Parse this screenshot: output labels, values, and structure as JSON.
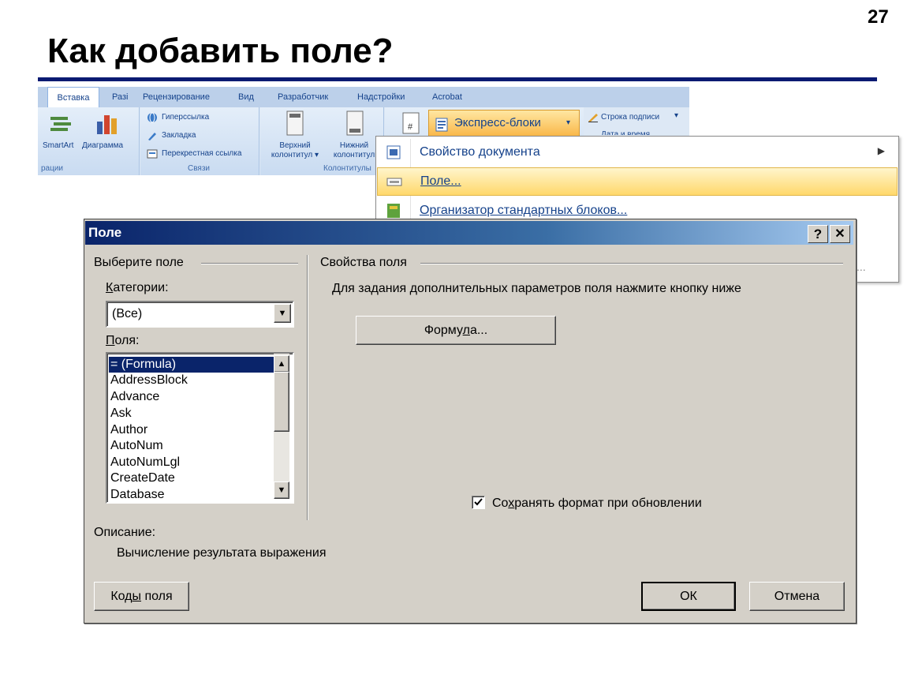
{
  "slide": {
    "number": "27",
    "title": "Как добавить поле?"
  },
  "ribbon": {
    "tabs": [
      {
        "label": "Вставка"
      },
      {
        "label": "Разі"
      },
      {
        "label": "Рецензирование"
      },
      {
        "label": "Вид"
      },
      {
        "label": "Разработчик"
      },
      {
        "label": "Надстройки"
      },
      {
        "label": "Acrobat"
      }
    ],
    "illustrations": {
      "smartart": "SmartArt",
      "chart": "Диаграмма",
      "group_label": "рации"
    },
    "links": {
      "hyperlink": "Гиперссылка",
      "bookmark": "Закладка",
      "crossref": "Перекрестная ссылка",
      "group_label": "Связи"
    },
    "header_footer": {
      "header_line1": "Верхний",
      "header_line2": "колонтитул ▾",
      "footer_line1": "Нижний",
      "footer_line2": "колонтитул",
      "group_label": "Колонтитулы"
    },
    "express_blocks": "Экспресс-блоки",
    "signature_line": "Строка подписи",
    "datetime_partial": "Дата и время"
  },
  "menu": {
    "items": [
      {
        "label": "Свойство документа",
        "has_submenu": true
      },
      {
        "label": "Поле...",
        "highlighted": true
      },
      {
        "label": "Организатор стандартных блоков..."
      }
    ],
    "ellipsis": "..."
  },
  "dialog": {
    "title": "Поле",
    "help": "?",
    "close": "✕",
    "select_field_group": "Выберите поле",
    "categories_label": "Категории:",
    "categories_value": "(Все)",
    "fields_label": "Поля:",
    "fields": [
      "= (Formula)",
      "AddressBlock",
      "Advance",
      "Ask",
      "Author",
      "AutoNum",
      "AutoNumLgl",
      "CreateDate",
      "Database"
    ],
    "selected_field": "= (Formula)",
    "props_group": "Свойства поля",
    "props_hint": "Для задания дополнительных параметров поля нажмите кнопку ниже",
    "formula_button": "Формула...",
    "preserve_format": "Сохранять формат при обновлении",
    "preserve_checked": true,
    "description_label": "Описание:",
    "description_text": "Вычисление результата выражения",
    "field_codes_button": "Коды поля",
    "ok_button": "ОК",
    "cancel_button": "Отмена"
  }
}
